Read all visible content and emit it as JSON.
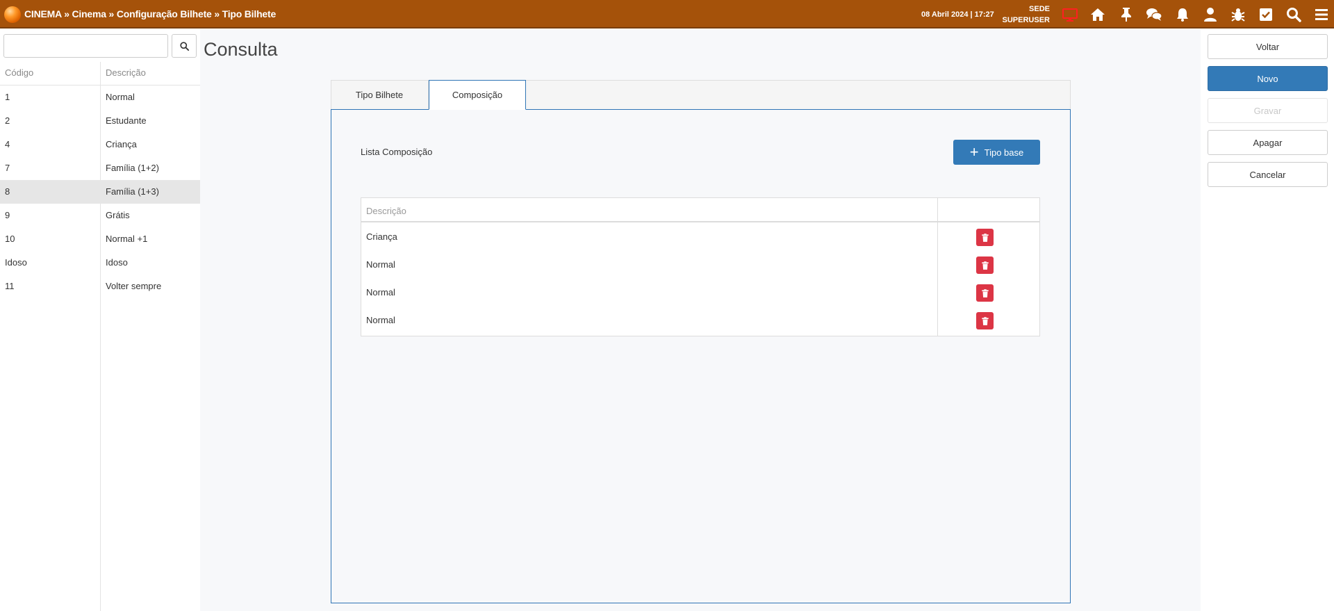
{
  "header": {
    "breadcrumb": [
      "CINEMA",
      "Cinema",
      "Configuração Bilhete",
      "Tipo Bilhete"
    ],
    "separator": " » ",
    "datetime": "08 Abril 2024 | 17:27",
    "location": "SEDE",
    "user": "SUPERUSER",
    "icons": [
      "monitor-icon",
      "home-icon",
      "pin-icon",
      "chat-icon",
      "bell-icon",
      "user-icon",
      "bug-icon",
      "checkbox-icon",
      "search-icon",
      "menu-icon"
    ],
    "accent_color": "#a5520a",
    "monitor_icon_color": "#ff0000"
  },
  "left_list": {
    "search": {
      "value": "",
      "placeholder": ""
    },
    "columns": [
      "Código",
      "Descrição"
    ],
    "rows": [
      {
        "code": "1",
        "description": "Normal"
      },
      {
        "code": "2",
        "description": "Estudante"
      },
      {
        "code": "4",
        "description": "Criança"
      },
      {
        "code": "7",
        "description": "Família (1+2)"
      },
      {
        "code": "8",
        "description": "Família (1+3)"
      },
      {
        "code": "9",
        "description": "Grátis"
      },
      {
        "code": "10",
        "description": "Normal +1"
      },
      {
        "code": "Idoso",
        "description": "Idoso"
      },
      {
        "code": "11",
        "description": "Volter sempre"
      }
    ],
    "selected_code": "8"
  },
  "main": {
    "title": "Consulta",
    "tabs": [
      {
        "label": "Tipo Bilhete",
        "active": false
      },
      {
        "label": "Composição",
        "active": true
      }
    ],
    "composition": {
      "label": "Lista Composição",
      "add_button": "Tipo base",
      "table_header": "Descrição",
      "rows": [
        "Criança",
        "Normal",
        "Normal",
        "Normal"
      ]
    }
  },
  "actions": [
    {
      "label": "Voltar",
      "style": "default"
    },
    {
      "label": "Novo",
      "style": "primary"
    },
    {
      "label": "Gravar",
      "style": "disabled"
    },
    {
      "label": "Apagar",
      "style": "default"
    },
    {
      "label": "Cancelar",
      "style": "default"
    }
  ],
  "colors": {
    "primary": "#337ab7",
    "danger": "#dc3545"
  }
}
